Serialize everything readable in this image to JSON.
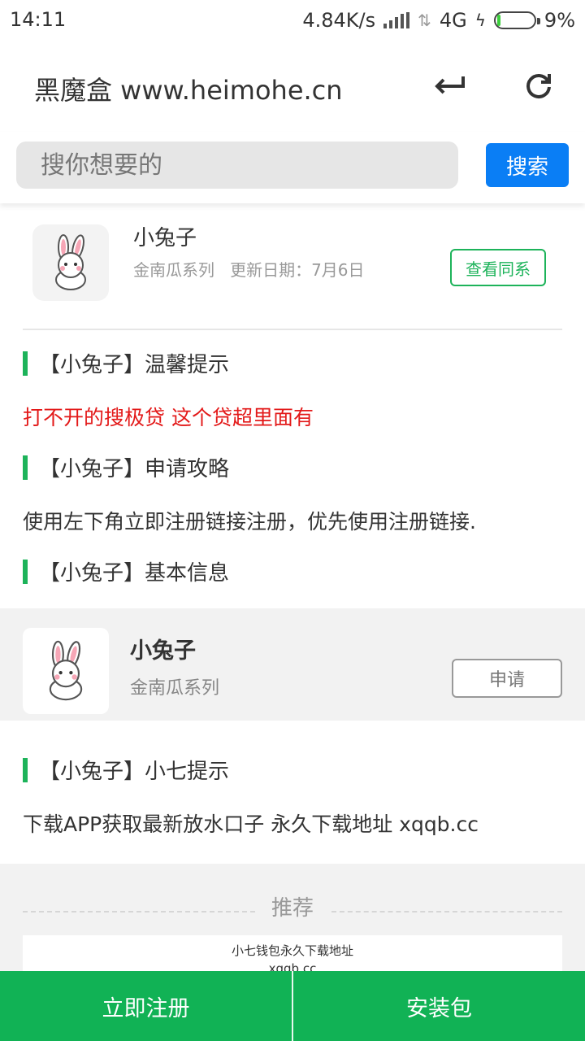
{
  "status_bar": {
    "time": "14:11",
    "speed": "4.84K/s",
    "network": "4G",
    "battery": "9%",
    "battery_level": 0.09
  },
  "header": {
    "title": "黑魔盒 www.heimohe.cn"
  },
  "search": {
    "placeholder": "搜你想要的",
    "button_label": "搜索"
  },
  "app": {
    "name": "小兔子",
    "series": "金南瓜系列",
    "update_label": "更新日期：7月6日",
    "view_series_label": "查看同系"
  },
  "sections": {
    "tip_heading": "【小兔子】温馨提示",
    "tip_text": "打不开的搜极贷 这个贷超里面有",
    "guide_heading": "【小兔子】申请攻略",
    "guide_text": "使用左下角立即注册链接注册，优先使用注册链接.",
    "info_heading": "【小兔子】基本信息",
    "hint_heading": "【小兔子】小七提示",
    "hint_text": "下载APP获取最新放水口子 永久下载地址 xqqb.cc"
  },
  "apply_card": {
    "name": "小兔子",
    "series": "金南瓜系列",
    "button_label": "申请"
  },
  "recommend": {
    "title": "推荐",
    "card_line1": "小七钱包永久下载地址",
    "card_line2": "xqqb.cc"
  },
  "bottom_bar": {
    "register_label": "立即注册",
    "install_label": "安装包"
  },
  "colors": {
    "accent_green": "#1db35a",
    "search_blue": "#0a7ef5",
    "warning_red": "#e31919"
  }
}
